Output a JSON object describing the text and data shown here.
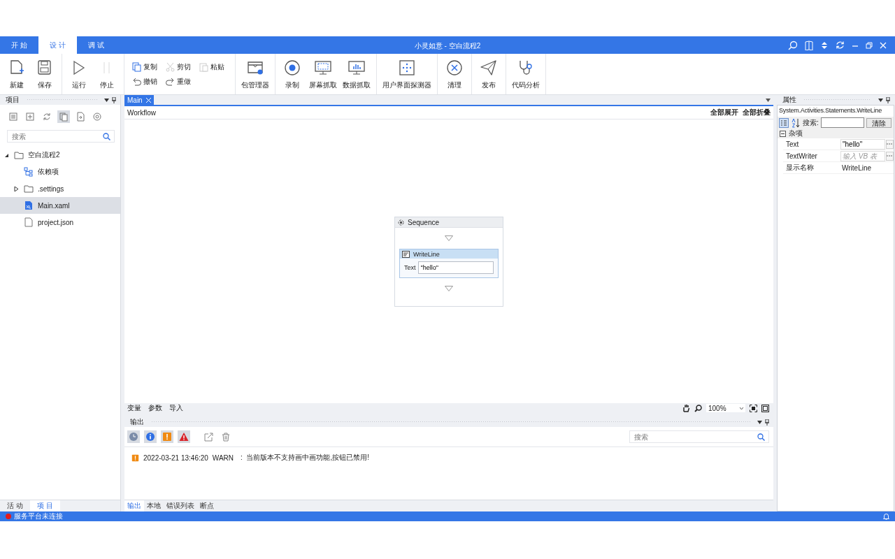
{
  "window": {
    "title": "小灵如意 - 空白流程2"
  },
  "menu_tabs": [
    {
      "label": "开 始",
      "selected": false
    },
    {
      "label": "设 计",
      "selected": true
    },
    {
      "label": "调 试",
      "selected": false
    }
  ],
  "ribbon": [
    {
      "items": [
        {
          "label": "新建",
          "kind": "large"
        },
        {
          "label": "保存",
          "kind": "large"
        }
      ]
    },
    {
      "items": [
        {
          "label": "运行",
          "kind": "large"
        },
        {
          "label": "停止",
          "kind": "large",
          "disabled": true
        }
      ]
    },
    {
      "items": [
        {
          "label": "复制",
          "kind": "small"
        },
        {
          "label": "剪切",
          "kind": "small",
          "disabled": true
        },
        {
          "label": "粘贴",
          "kind": "small",
          "disabled": true
        },
        {
          "label": "撤销",
          "kind": "small"
        },
        {
          "label": "重做",
          "kind": "small"
        }
      ]
    },
    {
      "items": [
        {
          "label": "包管理器",
          "kind": "large"
        }
      ]
    },
    {
      "items": [
        {
          "label": "录制",
          "kind": "large"
        },
        {
          "label": "屏幕抓取",
          "kind": "large"
        },
        {
          "label": "数据抓取",
          "kind": "large"
        }
      ]
    },
    {
      "items": [
        {
          "label": "用户界面探测器",
          "kind": "large"
        }
      ]
    },
    {
      "items": [
        {
          "label": "清理",
          "kind": "large"
        }
      ]
    },
    {
      "items": [
        {
          "label": "发布",
          "kind": "large"
        }
      ]
    },
    {
      "items": [
        {
          "label": "代码分析",
          "kind": "large"
        }
      ]
    }
  ],
  "project_panel": {
    "title": "项目",
    "toolbar": [
      {
        "selected": false
      },
      {
        "selected": false
      },
      {
        "selected": false
      },
      {
        "selected": true
      },
      {
        "selected": false
      },
      {
        "selected": false
      }
    ],
    "search": {
      "placeholder": "搜索"
    },
    "tree": [
      {
        "label": "空白流程2",
        "kind": "folder",
        "expanded": true,
        "selected": false,
        "children": [
          {
            "label": "依赖项",
            "kind": "deps",
            "selected": false
          },
          {
            "label": ".settings",
            "kind": "folder",
            "expanded": false,
            "selected": false
          },
          {
            "label": "Main.xaml",
            "kind": "xaml",
            "selected": true
          },
          {
            "label": "project.json",
            "kind": "file",
            "selected": false
          }
        ]
      }
    ],
    "tabs": [
      {
        "label": "活 动",
        "selected": false
      },
      {
        "label": "项 目",
        "selected": true
      }
    ]
  },
  "document_tabs": [
    {
      "label": "Main",
      "selected": true
    }
  ],
  "designer": {
    "breadcrumb": "Workflow",
    "expand_all": "全部展开",
    "collapse_all": "全部折叠",
    "sequence": {
      "title": "Sequence",
      "activities": [
        {
          "title": "WriteLine",
          "field_label": "Text",
          "field_value": "\"hello\""
        }
      ]
    },
    "footer_tabs": [
      "变量",
      "参数",
      "导入"
    ],
    "zoom": "100%"
  },
  "output_panel": {
    "title": "输出",
    "filters": [
      {
        "kind": "time",
        "selected": true
      },
      {
        "kind": "info",
        "selected": true
      },
      {
        "kind": "warn",
        "selected": true
      },
      {
        "kind": "error",
        "selected": true
      }
    ],
    "search": {
      "placeholder": "搜索"
    },
    "messages": [
      {
        "kind": "warn",
        "time": "2022-03-21 13:46:20",
        "level": "WARN",
        "text": ":  当前版本不支持画中画功能,按钮已禁用!"
      }
    ],
    "tabs": [
      {
        "label": "输出",
        "selected": true
      },
      {
        "label": "本地",
        "selected": false
      },
      {
        "label": "错误列表",
        "selected": false
      },
      {
        "label": "断点",
        "selected": false
      }
    ]
  },
  "properties_panel": {
    "title": "属性",
    "type_name": "System.Activities.Statements.WriteLine",
    "search_label": "搜索:",
    "clear_button": "清除",
    "categories": [
      {
        "name": "杂项",
        "expanded": true,
        "rows": [
          {
            "name": "Text",
            "value": "\"hello\"",
            "kind": "expression"
          },
          {
            "name": "TextWriter",
            "placeholder": "输入 VB 表",
            "kind": "expression"
          },
          {
            "name": "显示名称",
            "value": "WriteLine",
            "kind": "text"
          }
        ]
      }
    ]
  },
  "status_bar": {
    "text": "服务平台未连接",
    "connected": false
  }
}
